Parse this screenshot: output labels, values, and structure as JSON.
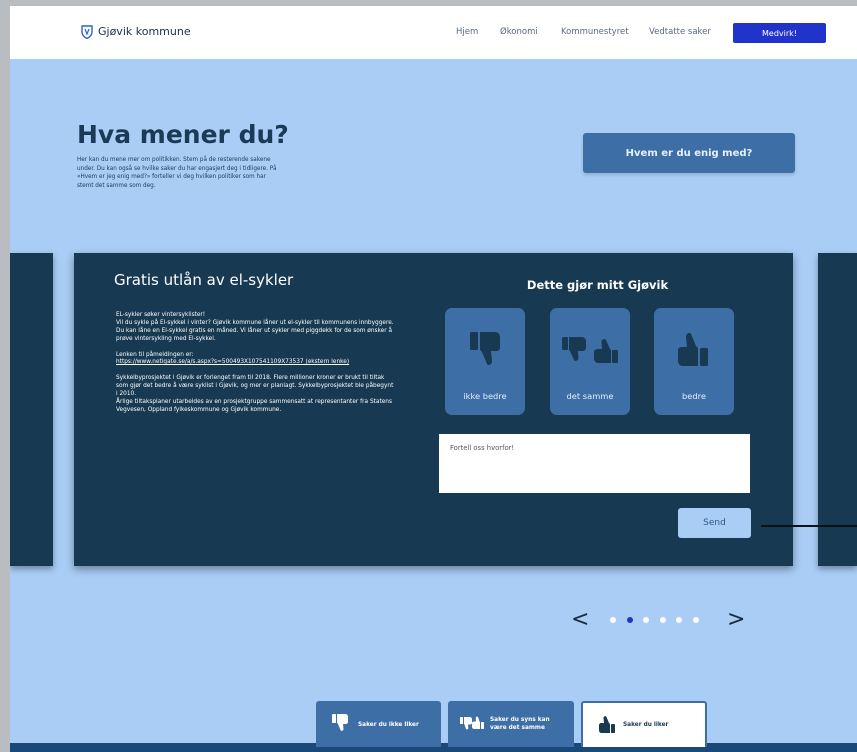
{
  "header": {
    "brand": "Gjøvik kommune",
    "nav": [
      "Hjem",
      "Økonomi",
      "Kommunestyret",
      "Vedtatte saker"
    ],
    "cta": "Medvirk!"
  },
  "intro": {
    "title": "Hva mener du?",
    "text": "Her kan du mene mer om politikken. Stem på de resterende sakene under.  Du kan også se hvilke saker du har engasjert deg i tidligere. På «Hvem er jeg enig med?» forteller vi deg hvilken politiker som har stemt det samme som deg.",
    "button": "Hvem er du enig med?"
  },
  "card": {
    "title": "Gratis utlån av el-sykler",
    "paragraphs": [
      "EL-sykler søker vintersyklister!",
      "Vil du sykle på El-sykkel i vinter? Gjøvik kommune låner ut el-sykler til kommunens innbyggere. Du kan låne en El-sykkel gratis en måned. Vi låner ut sykler med piggdekk for de som ønsker å prøve vintersykling med El-sykkel.",
      "Lenken til påmeldingen er:",
      "Sykkelbyprosjektet i Gjøvik er forlenget fram til 2018. Flere millioner kroner er brukt til tiltak som gjør det bedre å være syklist i Gjøvik, og mer er planlagt. Sykkelbyprosjektet ble påbegynt i 2010.",
      "Årlige tiltaksplaner utarbeides av en prosjektgruppe sammensatt at representanter fra Statens Vegvesen, Oppland fylkeskommune og Gjøvik kommune."
    ],
    "link": "https://www.netigate.se/a/s.aspx?s=500493X107541109X73537 (ekstern lenke)",
    "vote_heading": "Dette gjør mitt Gjøvik",
    "votes": [
      {
        "label": "ikke bedre",
        "icon": "thumbs-down-icon"
      },
      {
        "label": "det samme",
        "icon": "thumbs-down-up-icon"
      },
      {
        "label": "bedre",
        "icon": "thumbs-up-icon"
      }
    ],
    "placeholder": "Fortell oss hvorfor!",
    "send": "Send"
  },
  "pager": {
    "prev": "<",
    "next": ">",
    "dots": 6,
    "active_index": 1
  },
  "tabs": [
    {
      "label_lines": [
        "Saker du ikke liker"
      ],
      "icon": "thumbs-down-icon"
    },
    {
      "label_lines": [
        "Saker du syns kan",
        "være det samme"
      ],
      "icon": "thumbs-down-up-icon"
    },
    {
      "label_lines": [
        "Saker du liker"
      ],
      "icon": "thumbs-up-icon"
    }
  ],
  "colors": {
    "page_bg": "#a9cdf5",
    "card_bg": "#173a52",
    "button_blue": "#3d6fa6",
    "cta_blue": "#2233cc",
    "tab_selected_bg": "#ffffff"
  }
}
